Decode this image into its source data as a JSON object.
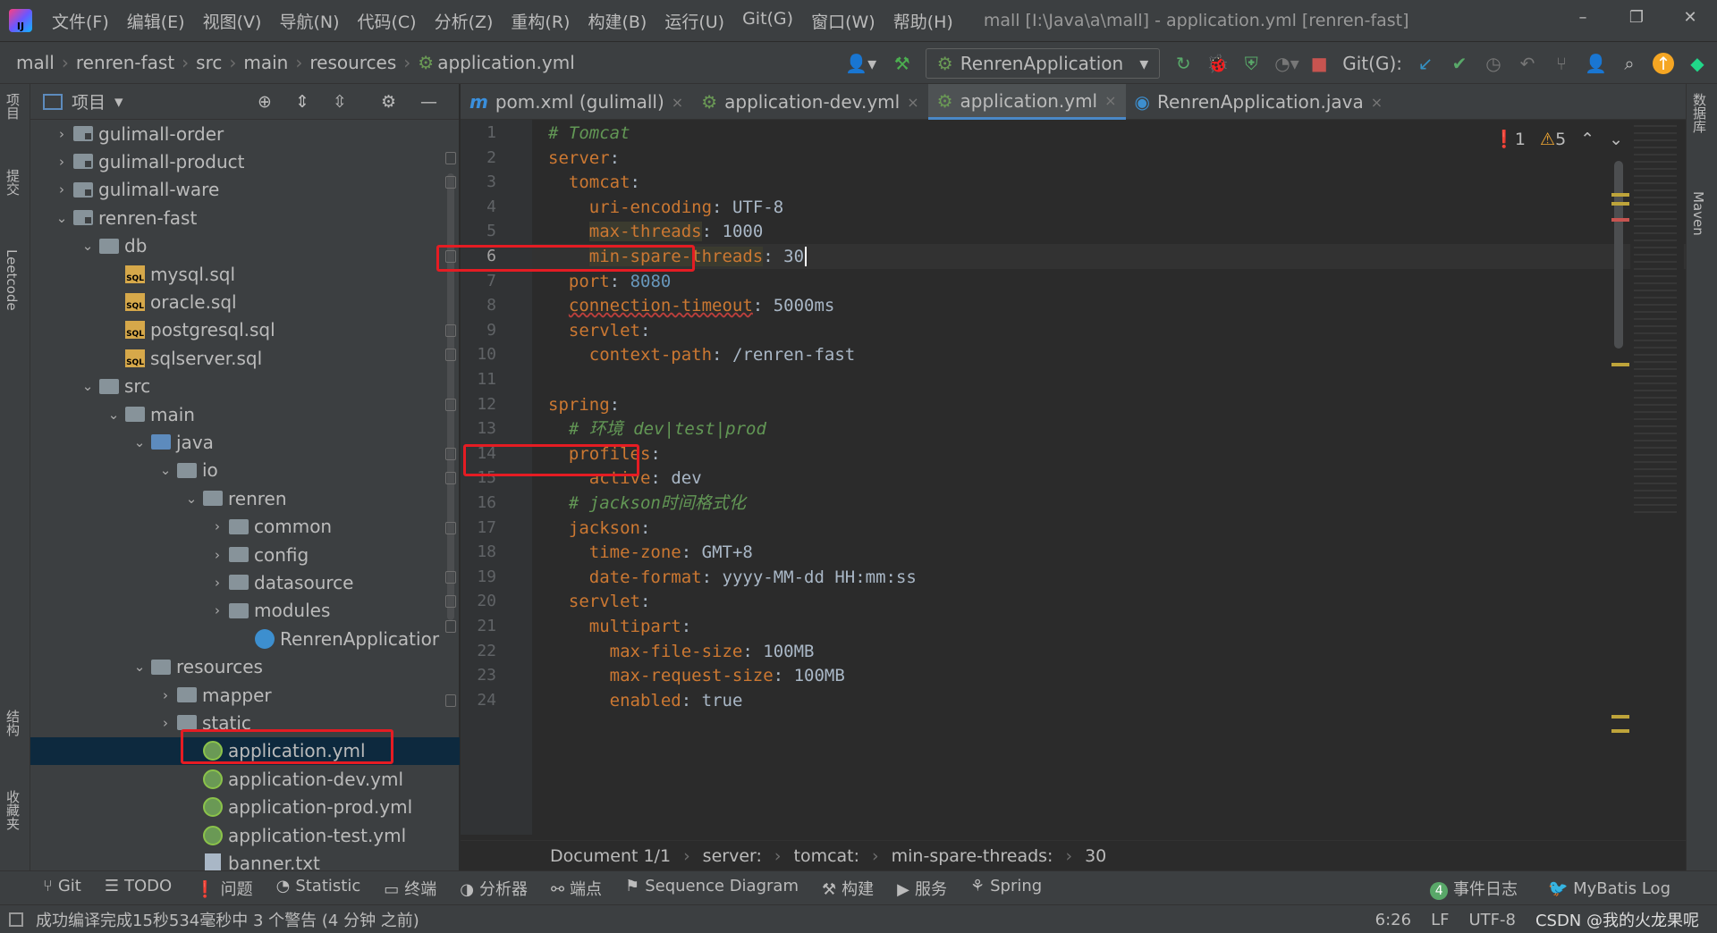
{
  "title_bar": {
    "menu": [
      "文件(F)",
      "编辑(E)",
      "视图(V)",
      "导航(N)",
      "代码(C)",
      "分析(Z)",
      "重构(R)",
      "构建(B)",
      "运行(U)",
      "Git(G)",
      "窗口(W)",
      "帮助(H)"
    ],
    "window_title": "mall [I:\\Java\\a\\mall] - application.yml [renren-fast]"
  },
  "nav": {
    "crumbs": [
      "mall",
      "renren-fast",
      "src",
      "main",
      "resources",
      "application.yml"
    ],
    "run_config": "RenrenApplication",
    "git_label": "Git(G):"
  },
  "left_stripe": {
    "project_label": "项目",
    "commit_label": "提交",
    "leetcode_label": "Leetcode",
    "structure_label": "结构",
    "favorites_label": "收藏夹"
  },
  "project_panel": {
    "header": "项目",
    "tree": [
      {
        "label": "gulimall-order"
      },
      {
        "label": "gulimall-product"
      },
      {
        "label": "gulimall-ware"
      },
      {
        "label": "renren-fast"
      },
      {
        "label": "db"
      },
      {
        "label": "mysql.sql"
      },
      {
        "label": "oracle.sql"
      },
      {
        "label": "postgresql.sql"
      },
      {
        "label": "sqlserver.sql"
      },
      {
        "label": "src"
      },
      {
        "label": "main"
      },
      {
        "label": "java"
      },
      {
        "label": "io"
      },
      {
        "label": "renren"
      },
      {
        "label": "common"
      },
      {
        "label": "config"
      },
      {
        "label": "datasource"
      },
      {
        "label": "modules"
      },
      {
        "label": "RenrenApplicatior"
      },
      {
        "label": "resources"
      },
      {
        "label": "mapper"
      },
      {
        "label": "static"
      },
      {
        "label": "application.yml"
      },
      {
        "label": "application-dev.yml"
      },
      {
        "label": "application-prod.yml"
      },
      {
        "label": "application-test.yml"
      },
      {
        "label": "banner.txt"
      }
    ]
  },
  "tabs": [
    "pom.xml (gulimall)",
    "application-dev.yml",
    "application.yml",
    "RenrenApplication.java"
  ],
  "editor": {
    "errors": "1",
    "warnings": "5",
    "lines": [
      {
        "n": "1",
        "key": "",
        "value": "",
        "comment": "# Tomcat"
      },
      {
        "n": "2",
        "key": "server",
        "value": ""
      },
      {
        "n": "3",
        "key": "  tomcat",
        "value": ""
      },
      {
        "n": "4",
        "key": "    uri-encoding",
        "value": "UTF-8"
      },
      {
        "n": "5",
        "key": "    max-threads",
        "value": "1000"
      },
      {
        "n": "6",
        "key": "    min-spare-threads",
        "value": "30"
      },
      {
        "n": "7",
        "key": "  port",
        "value": "8080"
      },
      {
        "n": "8",
        "key": "  connection-timeout",
        "value": "5000ms"
      },
      {
        "n": "9",
        "key": "  servlet",
        "value": ""
      },
      {
        "n": "10",
        "key": "    context-path",
        "value": "/renren-fast"
      },
      {
        "n": "11",
        "key": "",
        "value": ""
      },
      {
        "n": "12",
        "key": "spring",
        "value": ""
      },
      {
        "n": "13",
        "key": "",
        "value": "",
        "comment": "  # 环境 dev|test|prod"
      },
      {
        "n": "14",
        "key": "  profiles",
        "value": ""
      },
      {
        "n": "15",
        "key": "    active",
        "value": "dev"
      },
      {
        "n": "16",
        "key": "",
        "value": "",
        "comment": "  # jackson时间格式化"
      },
      {
        "n": "17",
        "key": "  jackson",
        "value": ""
      },
      {
        "n": "18",
        "key": "    time-zone",
        "value": "GMT+8"
      },
      {
        "n": "19",
        "key": "    date-format",
        "value": "yyyy-MM-dd HH:mm:ss"
      },
      {
        "n": "20",
        "key": "  servlet",
        "value": ""
      },
      {
        "n": "21",
        "key": "    multipart",
        "value": ""
      },
      {
        "n": "22",
        "key": "      max-file-size",
        "value": "100MB"
      },
      {
        "n": "23",
        "key": "      max-request-size",
        "value": "100MB"
      },
      {
        "n": "24",
        "key": "      enabled",
        "value": "true"
      }
    ],
    "breadcrumb": [
      "Document 1/1",
      "server:",
      "tomcat:",
      "min-spare-threads:",
      "30"
    ]
  },
  "right_stripe": {
    "database_label": "数据库",
    "maven_label": "Maven"
  },
  "bottom_tools": [
    "Git",
    "TODO",
    "问题",
    "Statistic",
    "终端",
    "分析器",
    "端点",
    "Sequence Diagram",
    "构建",
    "服务",
    "Spring"
  ],
  "bottom_right": {
    "events": "事件日志",
    "events_count": "4",
    "mybatis": "MyBatis Log"
  },
  "status": {
    "message": "成功编译完成15秒534毫秒中 3 个警告 (4 分钟 之前)",
    "position": "6:26",
    "line_sep": "LF",
    "encoding": "UTF-8",
    "watermark": "CSDN @我的火龙果呢"
  },
  "colors": {
    "keyword": "#cc7832",
    "comment": "#629755",
    "number": "#6897bb",
    "highlight_box": "#e51c23",
    "selection": "#0d293e"
  }
}
